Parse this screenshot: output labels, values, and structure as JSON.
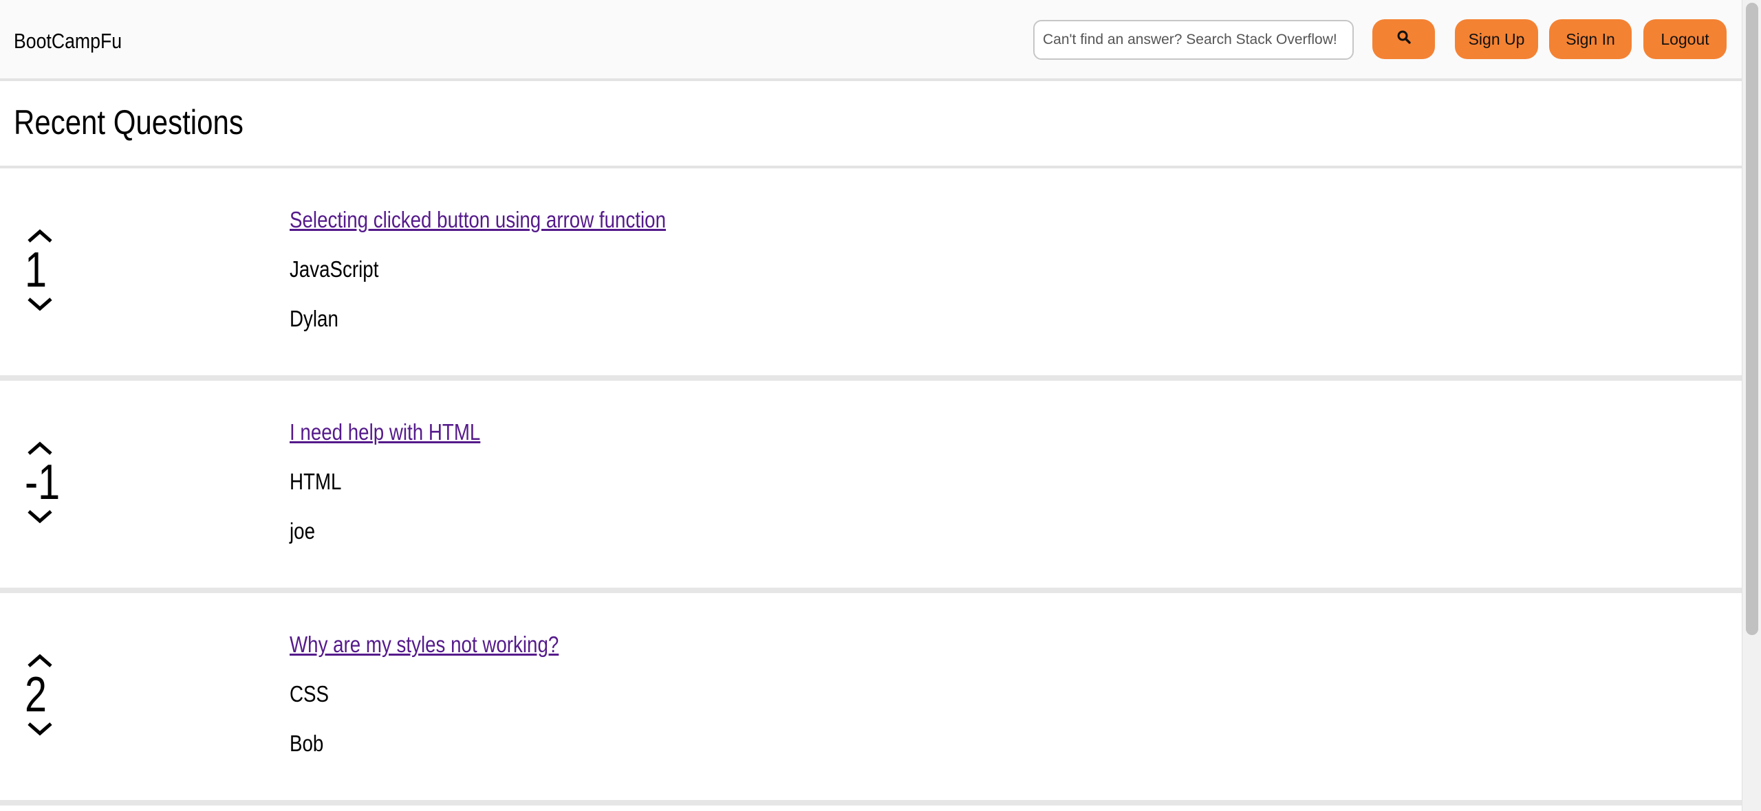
{
  "header": {
    "brand": "BootCampFu",
    "search": {
      "placeholder": "Can't find an answer? Search Stack Overflow!",
      "value": ""
    },
    "buttons": {
      "signup": "Sign Up",
      "signin": "Sign In",
      "logout": "Logout"
    }
  },
  "colors": {
    "accent": "#f48233",
    "link_visited": "#551a8b",
    "divider": "#e3e3e3"
  },
  "main": {
    "title": "Recent Questions",
    "questions": [
      {
        "votes": "1",
        "title": "Selecting clicked button using arrow function",
        "tag": "JavaScript",
        "author": "Dylan"
      },
      {
        "votes": "-1",
        "title": "I need help with HTML",
        "tag": "HTML",
        "author": "joe"
      },
      {
        "votes": "2",
        "title": "Why are my styles not working?",
        "tag": "CSS",
        "author": "Bob"
      }
    ]
  }
}
